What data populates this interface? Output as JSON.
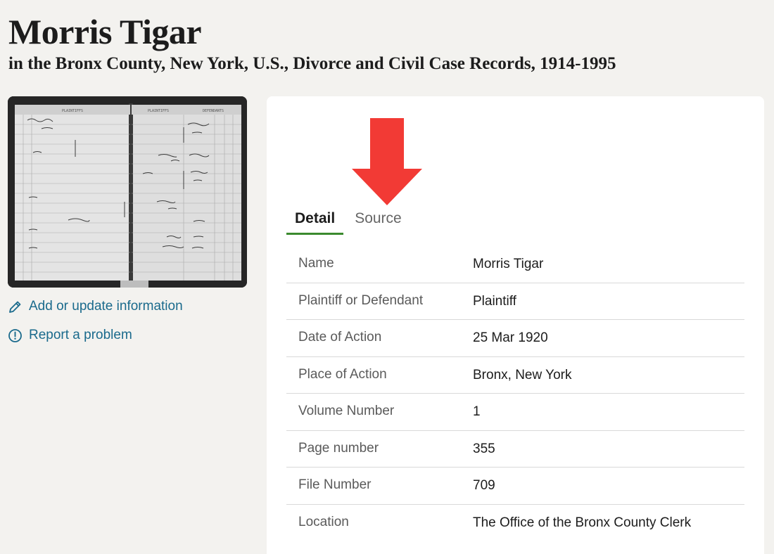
{
  "header": {
    "name": "Morris Tigar",
    "collection": "in the Bronx County, New York, U.S., Divorce and Civil Case Records, 1914-1995"
  },
  "thumbnail": {
    "icon": "record-image",
    "page_headings": [
      "PLAINTIFFS",
      "PLAINTIFFS",
      "DEFENDANTS"
    ]
  },
  "sidebar": {
    "add_label": "Add or update information",
    "report_label": "Report a problem",
    "add_icon": "pencil-icon",
    "report_icon": "alert-circle-icon",
    "link_color": "#1a6a8c"
  },
  "annotation": {
    "icon": "down-arrow",
    "color": "#f23a35"
  },
  "tabs": [
    {
      "label": "Detail",
      "active": true
    },
    {
      "label": "Source",
      "active": false
    }
  ],
  "details": [
    {
      "label": "Name",
      "value": "Morris Tigar"
    },
    {
      "label": "Plaintiff or Defendant",
      "value": "Plaintiff"
    },
    {
      "label": "Date of Action",
      "value": "25 Mar 1920"
    },
    {
      "label": "Place of Action",
      "value": "Bronx, New York"
    },
    {
      "label": "Volume Number",
      "value": "1"
    },
    {
      "label": "Page number",
      "value": "355"
    },
    {
      "label": "File Number",
      "value": "709"
    },
    {
      "label": "Location",
      "value": "The Office of the Bronx County Clerk"
    }
  ],
  "colors": {
    "background": "#f3f2ef",
    "tab_active_underline": "#3b8a2e"
  }
}
